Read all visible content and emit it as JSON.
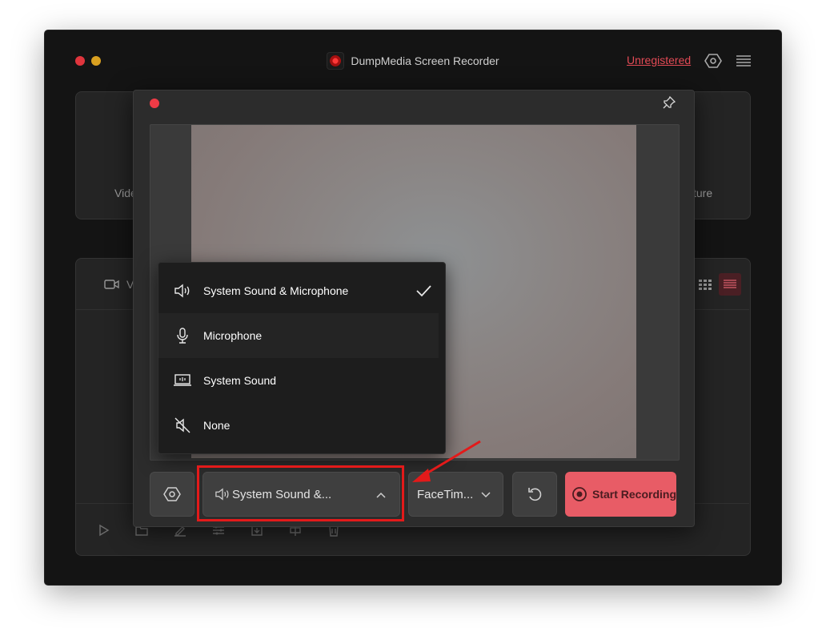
{
  "window": {
    "title": "DumpMedia Screen Recorder",
    "traffic_colors": {
      "close": "#e0353d",
      "minimize": "#d9a020"
    },
    "unregistered_label": "Unregistered",
    "top_icons": [
      "settings-gear-icon",
      "menu-hamburger-icon"
    ]
  },
  "background": {
    "mode_left_partial_label": "Vide",
    "mode_right_partial_label": "ture",
    "list_header_partial_label": "V",
    "view_icons": [
      "grid-view-icon",
      "list-view-icon"
    ],
    "bottom_toolbar_icons": [
      "play-icon",
      "folder-icon",
      "edit-icon",
      "adjust-icon",
      "download-icon",
      "split-icon",
      "trash-icon"
    ]
  },
  "dialog": {
    "close_color": "#ee3b46",
    "pin_icon": "pin-icon"
  },
  "audio_menu": {
    "items": [
      {
        "label": "System Sound & Microphone",
        "icon": "speaker-icon",
        "checked": true
      },
      {
        "label": "Microphone",
        "icon": "microphone-icon",
        "checked": false
      },
      {
        "label": "System Sound",
        "icon": "system-sound-icon",
        "checked": false
      },
      {
        "label": "None",
        "icon": "speaker-muted-icon",
        "checked": false
      }
    ]
  },
  "toolbar": {
    "settings_icon": "settings-gear-icon",
    "audio_select_label": "System Sound &...",
    "camera_select_label": "FaceTim...",
    "reset_icon": "rotate-icon",
    "start_label": "Start Recording",
    "start_color": "#e85c66"
  },
  "annotation": {
    "highlight_color": "#e31a1a"
  }
}
